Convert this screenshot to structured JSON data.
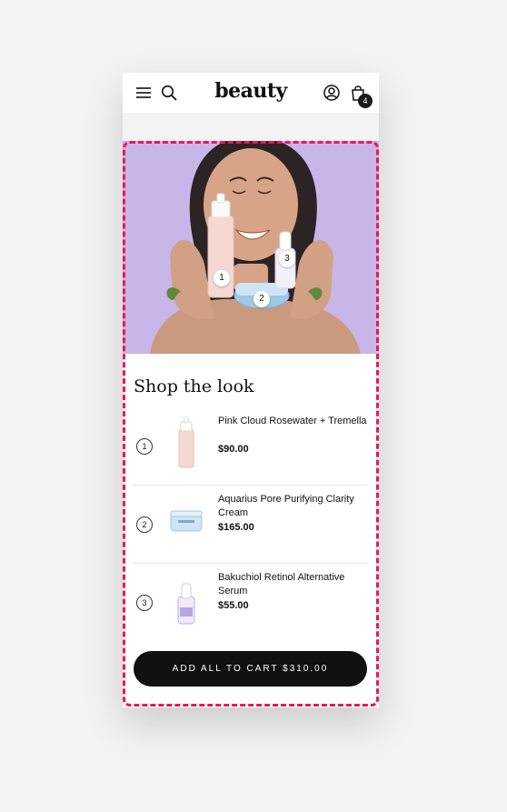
{
  "header": {
    "logo": "beauty",
    "cart_count": "4",
    "icons": [
      "menu-icon",
      "search-icon",
      "account-icon",
      "bag-icon"
    ]
  },
  "hero": {
    "hotspots": [
      "1",
      "2",
      "3"
    ],
    "background_color": "#c9b6e8"
  },
  "section": {
    "title": "Shop the look"
  },
  "products": [
    {
      "number": "1",
      "name": "Pink Cloud Rosewater + Tremella",
      "price": "$90.00"
    },
    {
      "number": "2",
      "name": "Aquarius Pore Purifying Clarity Cream",
      "price": "$165.00"
    },
    {
      "number": "3",
      "name": "Bakuchiol Retinol Alternative Serum",
      "price": "$55.00"
    }
  ],
  "cta": {
    "label": "ADD ALL TO CART $310.00"
  },
  "colors": {
    "highlight": "#e8175d",
    "button": "#111111"
  }
}
